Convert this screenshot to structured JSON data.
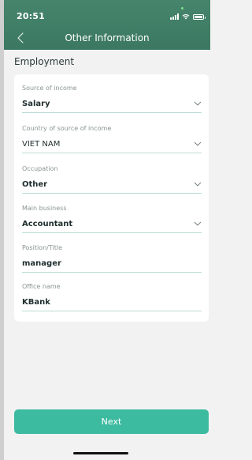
{
  "status_bar": {
    "time": "20:51",
    "icons": [
      "signal-icon",
      "wifi-icon",
      "battery-icon"
    ]
  },
  "header": {
    "title": "Other Information",
    "back_icon": "chevron-left-icon"
  },
  "section": {
    "title": "Employment"
  },
  "fields": [
    {
      "label": "Source of income",
      "value": "Salary",
      "type": "dropdown"
    },
    {
      "label": "Country of source of income",
      "value": "VIET NAM",
      "type": "dropdown"
    },
    {
      "label": "Occupation",
      "value": "Other",
      "type": "dropdown"
    },
    {
      "label": "Main business",
      "value": "Accountant",
      "type": "dropdown"
    },
    {
      "label": "Position/Title",
      "value": "manager",
      "type": "text"
    },
    {
      "label": "Office name",
      "value": "KBank",
      "type": "text"
    }
  ],
  "footer": {
    "next_label": "Next"
  },
  "colors": {
    "header_bg": "#3f7c64",
    "accent": "#3dbba0",
    "underline": "#b9dcd6",
    "page_bg": "#f2f2f2"
  }
}
